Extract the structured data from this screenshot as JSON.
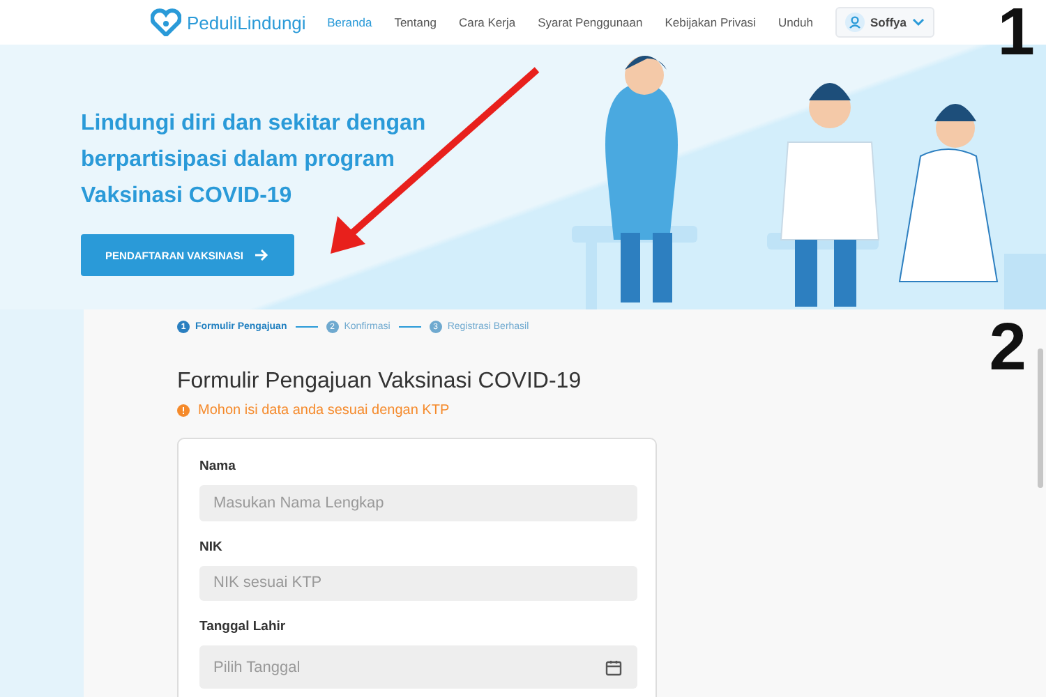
{
  "header": {
    "logo_text": "PeduliLindungi",
    "nav": [
      {
        "label": "Beranda",
        "selected": true
      },
      {
        "label": "Tentang",
        "selected": false
      },
      {
        "label": "Cara Kerja",
        "selected": false
      },
      {
        "label": "Syarat Penggunaan",
        "selected": false
      },
      {
        "label": "Kebijakan Privasi",
        "selected": false
      },
      {
        "label": "Unduh",
        "selected": false
      }
    ],
    "user": "Soffya"
  },
  "hero": {
    "headline": "Lindungi diri dan sekitar dengan berpartisipasi dalam program Vaksinasi COVID-19",
    "button": "PENDAFTARAN VAKSINASI"
  },
  "steps": [
    {
      "number": "1",
      "label": "Formulir Pengajuan",
      "selected": true
    },
    {
      "number": "2",
      "label": "Konfirmasi",
      "selected": false
    },
    {
      "number": "3",
      "label": "Registrasi Berhasil",
      "selected": false
    }
  ],
  "form": {
    "title": "Formulir Pengajuan Vaksinasi COVID-19",
    "notice": "Mohon isi data anda sesuai dengan KTP",
    "fields": [
      {
        "label": "Nama",
        "placeholder": "Masukan Nama Lengkap",
        "kind": "text"
      },
      {
        "label": "NIK",
        "placeholder": "NIK sesuai KTP",
        "kind": "text"
      },
      {
        "label": "Tanggal Lahir",
        "placeholder": "Pilih Tanggal",
        "kind": "date"
      }
    ]
  },
  "annotations": [
    "1",
    "2"
  ]
}
